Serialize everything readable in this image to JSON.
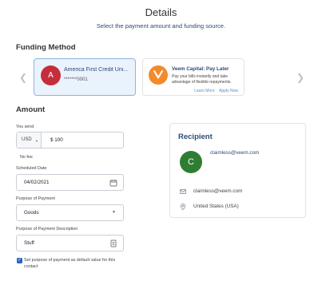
{
  "header": {
    "title": "Details",
    "subtitle": "Select the payment amount and funding source."
  },
  "funding": {
    "heading": "Funding Method",
    "cards": [
      {
        "avatar_letter": "A",
        "name": "America First Credit Uni...",
        "account_masked": "*******0001",
        "selected": true
      },
      {
        "title": "Veem Capital: Pay Later",
        "description": "Pay your bills instantly and take advantage of flexible repayments.",
        "learn_more": "Learn More",
        "apply_now": "Apply Now"
      }
    ],
    "prev_icon": "chevron-left-icon",
    "next_icon": "chevron-right-icon"
  },
  "amount": {
    "heading": "Amount",
    "you_send_label": "You send",
    "currency": "USD",
    "value": "$ 100",
    "fee_note": "No fee"
  },
  "scheduled_date": {
    "label": "Scheduled Date",
    "value": "04/02/2021",
    "icon": "calendar-icon"
  },
  "purpose": {
    "label": "Purpose of Payment",
    "value": "Goods",
    "icon": "chevron-down-icon"
  },
  "purpose_description": {
    "label": "Purpose of Payment Description",
    "value": "Stuff",
    "icon": "notes-icon"
  },
  "default_checkbox": {
    "checked": true,
    "label": "Set purpose of payment as default value for this contact"
  },
  "recipient": {
    "heading": "Recipient",
    "avatar_letter": "C",
    "email_top": "claimless@veem.com",
    "email": "claimless@veem.com",
    "location": "United States (USA)"
  },
  "colors": {
    "brand_blue": "#2d4a7a",
    "selected_card_bg": "#eaf2fc",
    "avatar_red": "#c62d3a",
    "avatar_green": "#2e7d32",
    "veem_orange": "#f38b2a",
    "checkbox_blue": "#2a66c5"
  }
}
